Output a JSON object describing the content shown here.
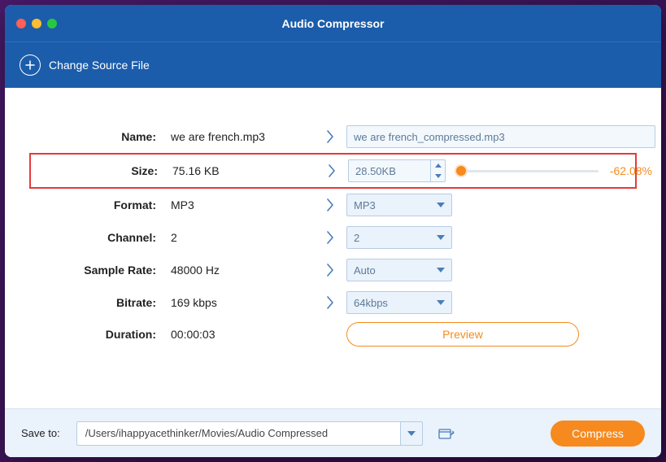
{
  "window": {
    "title": "Audio Compressor"
  },
  "toolbar": {
    "change_source_label": "Change Source File"
  },
  "labels": {
    "name": "Name:",
    "size": "Size:",
    "format": "Format:",
    "channel": "Channel:",
    "sample_rate": "Sample Rate:",
    "bitrate": "Bitrate:",
    "duration": "Duration:"
  },
  "source": {
    "name": "we are french.mp3",
    "size": "75.16 KB",
    "format": "MP3",
    "channel": "2",
    "sample_rate": "48000 Hz",
    "bitrate": "169 kbps",
    "duration": "00:00:03"
  },
  "target": {
    "name": "we are french_compressed.mp3",
    "size": "28.50KB",
    "size_change_pct": "-62.08%",
    "slider_pos_pct": 2,
    "format": "MP3",
    "channel": "2",
    "sample_rate": "Auto",
    "bitrate": "64kbps"
  },
  "preview": {
    "button_label": "Preview"
  },
  "footer": {
    "save_to_label": "Save to:",
    "save_path": "/Users/ihappyacethinker/Movies/Audio Compressed",
    "compress_label": "Compress"
  },
  "colors": {
    "header": "#1b5dab",
    "accent": "#f68a1e",
    "highlight_border": "#e43a3a"
  }
}
